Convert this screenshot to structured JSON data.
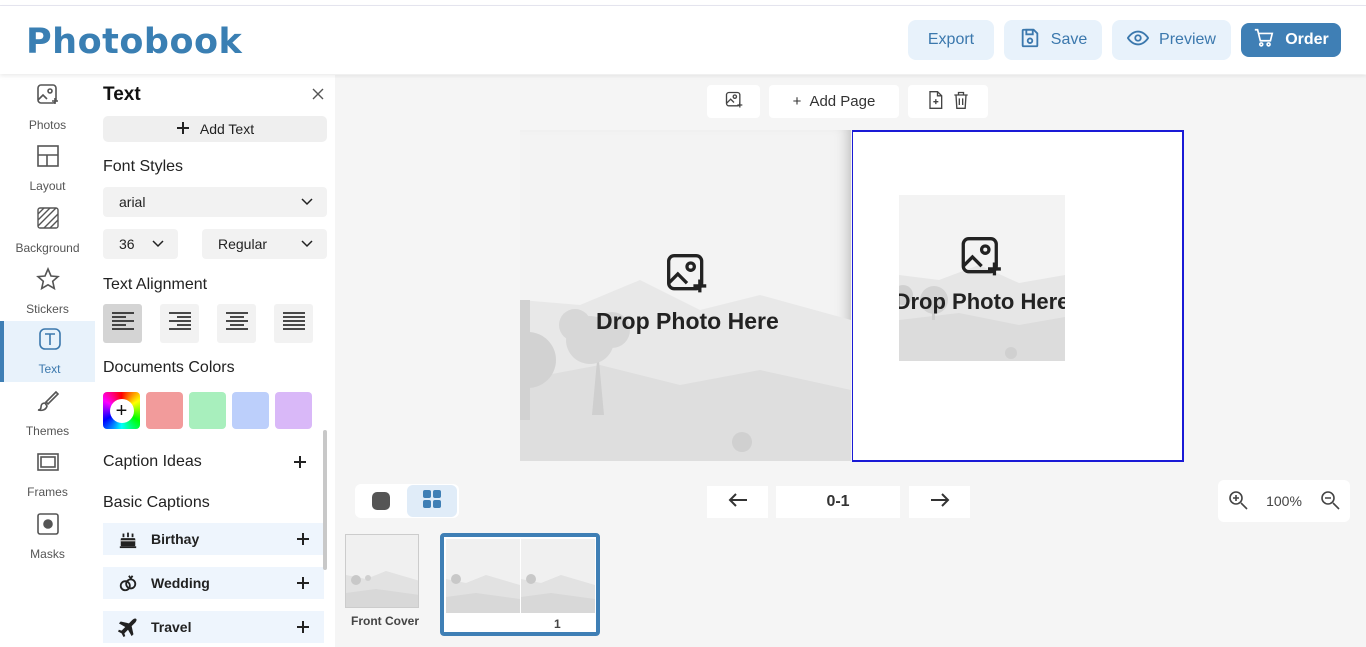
{
  "app": {
    "logo": "Photobook"
  },
  "header": {
    "export_label": "Export",
    "save_label": "Save",
    "preview_label": "Preview",
    "order_label": "Order"
  },
  "rail": {
    "items": [
      {
        "label": "Photos",
        "icon": "photo-add-icon"
      },
      {
        "label": "Layout",
        "icon": "layout-icon"
      },
      {
        "label": "Background",
        "icon": "background-icon"
      },
      {
        "label": "Stickers",
        "icon": "star-icon"
      },
      {
        "label": "Text",
        "icon": "text-icon",
        "active": true
      },
      {
        "label": "Themes",
        "icon": "brush-icon"
      },
      {
        "label": "Frames",
        "icon": "frame-icon"
      },
      {
        "label": "Masks",
        "icon": "mask-icon"
      }
    ]
  },
  "panel": {
    "title": "Text",
    "add_text_label": "Add Text",
    "font_styles_label": "Font Styles",
    "font_family": "arial",
    "font_size": "36",
    "font_weight": "Regular",
    "alignment_label": "Text Alignment",
    "alignments": [
      "left",
      "right",
      "center",
      "justify"
    ],
    "colors_label": "Documents Colors",
    "colors": [
      "#f29b9b",
      "#a8efbd",
      "#bccffb",
      "#d9b8f8"
    ],
    "caption_ideas_label": "Caption Ideas",
    "basic_captions_label": "Basic Captions",
    "captions": [
      {
        "label": "Birthay",
        "icon": "cake-icon"
      },
      {
        "label": "Wedding",
        "icon": "rings-icon"
      },
      {
        "label": "Travel",
        "icon": "airplane-icon"
      }
    ]
  },
  "canvas": {
    "add_page_label": "Add Page",
    "drop_label": "Drop Photo Here",
    "page_indicator": "0-1",
    "zoom_level": "100%",
    "border_color": "#1a1ad6"
  },
  "thumbnails": {
    "front_cover_label": "Front Cover",
    "spread_label": "1"
  },
  "colors": {
    "accent": "#3f7fb5",
    "logo": "#3a7fb3",
    "light_accent": "#e8f2fb"
  }
}
